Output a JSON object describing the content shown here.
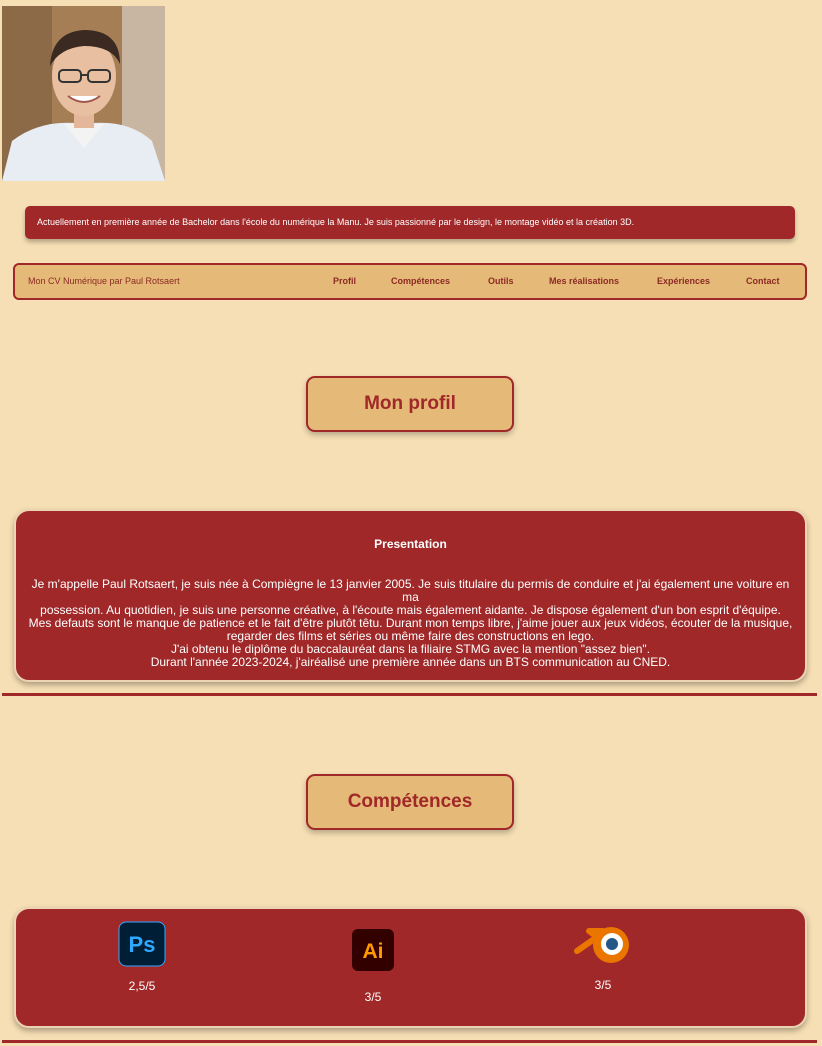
{
  "intro": {
    "text": "Actuellement en première année de Bachelor dans l'école du numérique la Manu. Je suis passionné par le design, le montage vidéo et la création 3D."
  },
  "nav": {
    "brand": "Mon CV Numérique par Paul Rotsaert",
    "links": [
      "Profil",
      "Compétences",
      "Outils",
      "Mes réalisations",
      "Expériences",
      "Contact"
    ]
  },
  "profile_section": {
    "title": "Mon profil",
    "card_title": "Presentation",
    "lines": [
      "Je m'appelle Paul Rotsaert, je suis née à Compiègne le 13 janvier 2005. Je suis titulaire du permis de conduire et j'ai également une voiture en ma",
      "possession. Au quotidien, je suis une personne créative, à l'écoute mais également aidante. Je dispose également d'un bon esprit d'équipe.",
      "Mes defauts sont le manque de patience et le fait d'être plutôt têtu. Durant mon temps libre, j'aime jouer aux jeux vidéos, écouter de la musique,",
      "regarder des films et séries ou même faire des constructions en lego.",
      "J'ai obtenu le diplôme du baccalauréat dans la filiaire STMG avec la mention \"assez bien\".",
      "Durant l'année 2023-2024, j'airéalisé une première année dans un BTS communication au CNED."
    ]
  },
  "skills_section": {
    "title": "Compétences",
    "skills": [
      {
        "icon": "photoshop-icon",
        "icon_text": "Ps",
        "rating": "2,5/5"
      },
      {
        "icon": "illustrator-icon",
        "icon_text": "Ai",
        "rating": "3/5"
      },
      {
        "icon": "blender-icon",
        "rating": "3/5"
      }
    ]
  },
  "colors": {
    "background": "#f6dfb4",
    "accent_red": "#a02829",
    "accent_tan": "#e5b978"
  }
}
